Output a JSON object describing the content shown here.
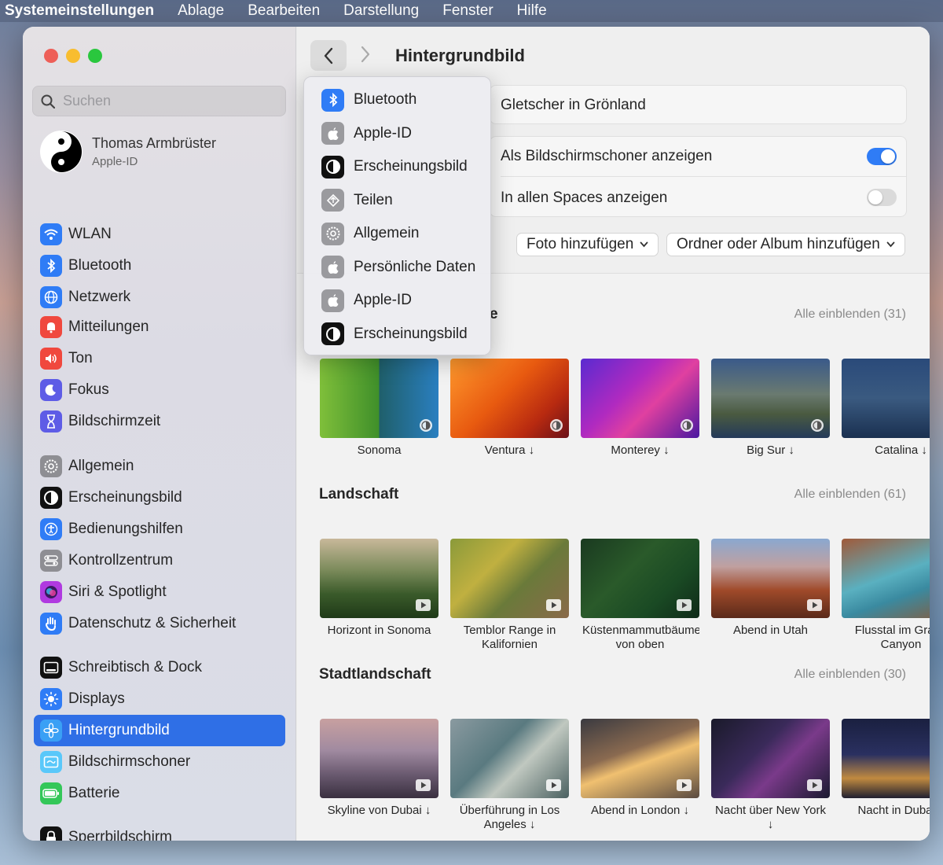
{
  "menubar": {
    "app": "Systemeinstellungen",
    "items": [
      "Ablage",
      "Bearbeiten",
      "Darstellung",
      "Fenster",
      "Hilfe"
    ]
  },
  "sidebar": {
    "search_placeholder": "Suchen",
    "user": {
      "name": "Thomas Armbrüster",
      "sub": "Apple-ID"
    },
    "groups": [
      [
        {
          "label": "WLAN",
          "icon": "wifi-icon",
          "color": "#2f7cf6"
        },
        {
          "label": "Bluetooth",
          "icon": "bluetooth-icon",
          "color": "#2f7cf6"
        },
        {
          "label": "Netzwerk",
          "icon": "globe-icon",
          "color": "#2f7cf6"
        }
      ],
      [
        {
          "label": "Mitteilungen",
          "icon": "bell-icon",
          "color": "#f0483e"
        },
        {
          "label": "Ton",
          "icon": "speaker-icon",
          "color": "#f0483e"
        },
        {
          "label": "Fokus",
          "icon": "moon-icon",
          "color": "#5e5ce6"
        },
        {
          "label": "Bildschirmzeit",
          "icon": "hourglass-icon",
          "color": "#5e5ce6"
        }
      ],
      [
        {
          "label": "Allgemein",
          "icon": "gear-icon",
          "color": "#8e8e93"
        },
        {
          "label": "Erscheinungsbild",
          "icon": "appearance-icon",
          "color": "#111111"
        },
        {
          "label": "Bedienungshilfen",
          "icon": "accessibility-icon",
          "color": "#2f7cf6"
        },
        {
          "label": "Kontrollzentrum",
          "icon": "toggles-icon",
          "color": "#8e8e93"
        },
        {
          "label": "Siri & Spotlight",
          "icon": "siri-icon",
          "color": "#b03ae0"
        },
        {
          "label": "Datenschutz & Sicherheit",
          "icon": "hand-icon",
          "color": "#2f7cf6"
        }
      ],
      [
        {
          "label": "Schreibtisch & Dock",
          "icon": "dock-icon",
          "color": "#111111"
        },
        {
          "label": "Displays",
          "icon": "sun-icon",
          "color": "#2f7cf6"
        },
        {
          "label": "Hintergrundbild",
          "icon": "flower-icon",
          "color": "#3aa0f5",
          "active": true
        },
        {
          "label": "Bildschirmschoner",
          "icon": "screensaver-icon",
          "color": "#5ac8fa"
        },
        {
          "label": "Batterie",
          "icon": "battery-icon",
          "color": "#34c759"
        }
      ],
      [
        {
          "label": "Sperrbildschirm",
          "icon": "lock-icon",
          "color": "#111111"
        }
      ]
    ]
  },
  "main": {
    "title": "Hintergrundbild",
    "current_wallpaper": "Gletscher in Grönland",
    "toggle_screensaver": {
      "label": "Als Bildschirmschoner anzeigen",
      "on": true
    },
    "toggle_spaces": {
      "label": "In allen Spaces anzeigen",
      "on": false
    },
    "add_photo": "Foto hinzufügen",
    "add_folder": "Ordner oder Album hinzufügen"
  },
  "popup": [
    {
      "label": "Bluetooth",
      "icon": "bluetooth-icon",
      "color": "#2f7cf6"
    },
    {
      "label": "Apple-ID",
      "icon": "apple-icon",
      "color": "#9a9a9e"
    },
    {
      "label": "Erscheinungsbild",
      "icon": "appearance-icon",
      "color": "#111111"
    },
    {
      "label": "Teilen",
      "icon": "share-icon",
      "color": "#9a9a9e"
    },
    {
      "label": "Allgemein",
      "icon": "gear-icon",
      "color": "#9a9a9e"
    },
    {
      "label": "Persönliche Daten",
      "icon": "apple-icon",
      "color": "#9a9a9e"
    },
    {
      "label": "Apple-ID",
      "icon": "apple-icon",
      "color": "#9a9a9e"
    },
    {
      "label": "Erscheinungsbild",
      "icon": "appearance-icon",
      "color": "#111111"
    }
  ],
  "sections": [
    {
      "title": "e",
      "show_all": "Alle einblenden (31)",
      "tiles": [
        {
          "label": "Sonoma",
          "bg": "linear-gradient(90deg,#7fbf3a 0%,#3f8f2a 50%,#1f5f6a 50%,#2a7fc0 100%)",
          "kind": "dynamic"
        },
        {
          "label": "Ventura ↓",
          "bg": "linear-gradient(135deg,#ff9a2e 0%,#e85a10 45%,#b82a10 75%,#6a1018 100%)",
          "kind": "dynamic"
        },
        {
          "label": "Monterey ↓",
          "bg": "linear-gradient(135deg,#5a2ad0 0%,#b02ac0 40%,#e040a0 60%,#4a18a0 100%)",
          "kind": "dynamic"
        },
        {
          "label": "Big Sur ↓",
          "bg": "linear-gradient(180deg,#3a5a8a 0%,#6a7a70 45%,#4a5a40 70%,#243a5a 100%)",
          "kind": "dynamic"
        },
        {
          "label": "Catalina ↓",
          "bg": "linear-gradient(180deg,#2a4a7a 0%,#3a5a80 50%,#1a3050 100%)",
          "kind": "dynamic"
        }
      ]
    },
    {
      "title": "Landschaft",
      "show_all": "Alle einblenden (61)",
      "tiles": [
        {
          "label": "Horizont in Sonoma",
          "bg": "linear-gradient(180deg,#c8b89a 0%,#7a8a5a 40%,#3a5a2a 70%,#1f3a18 100%)",
          "kind": "video"
        },
        {
          "label": "Temblor Range in Kalifornien",
          "bg": "linear-gradient(135deg,#8a9a3a 0%,#c0b040 35%,#6a7a3a 60%,#8a6a4a 100%)",
          "kind": "video"
        },
        {
          "label": "Küstenmammutbäume von oben",
          "bg": "linear-gradient(135deg,#1a3a20 0%,#2a5a2a 40%,#1a4a24 70%,#0f2a18 100%)",
          "kind": "video"
        },
        {
          "label": "Abend in Utah",
          "bg": "linear-gradient(180deg,#8aa8d0 0%,#c0a0a0 35%,#a04a2a 65%,#5a2a1a 100%)",
          "kind": "video"
        },
        {
          "label": "Flusstal im Grand Canyon",
          "bg": "linear-gradient(160deg,#a05a3a 0%,#5ab0c0 45%,#3a8aa0 65%,#8a5a3a 100%)",
          "kind": "video"
        }
      ]
    },
    {
      "title": "Stadtlandschaft",
      "show_all": "Alle einblenden (30)",
      "tiles": [
        {
          "label": "Skyline von Dubai ↓",
          "bg": "linear-gradient(180deg,#c8a0a0 0%,#a08aa0 40%,#6a5a70 70%,#3a3040 100%)",
          "kind": "video"
        },
        {
          "label": "Überführung in Los Angeles ↓",
          "bg": "linear-gradient(135deg,#8a9aa0 0%,#5a7a80 40%,#c0c8c0 60%,#4a6060 100%)",
          "kind": "video"
        },
        {
          "label": "Abend in London ↓",
          "bg": "linear-gradient(160deg,#3a3a40 0%,#8a6a50 40%,#f0c070 55%,#5a4a40 100%)",
          "kind": "video"
        },
        {
          "label": "Nacht über New York ↓",
          "bg": "linear-gradient(135deg,#1a1a2a 0%,#3a2a5a 40%,#7a3a8a 60%,#1a1a30 100%)",
          "kind": "video"
        },
        {
          "label": "Nacht in Dubai ↓",
          "bg": "linear-gradient(180deg,#1a2040 0%,#2a3060 45%,#c08a40 75%,#202030 100%)",
          "kind": "video"
        }
      ]
    }
  ]
}
